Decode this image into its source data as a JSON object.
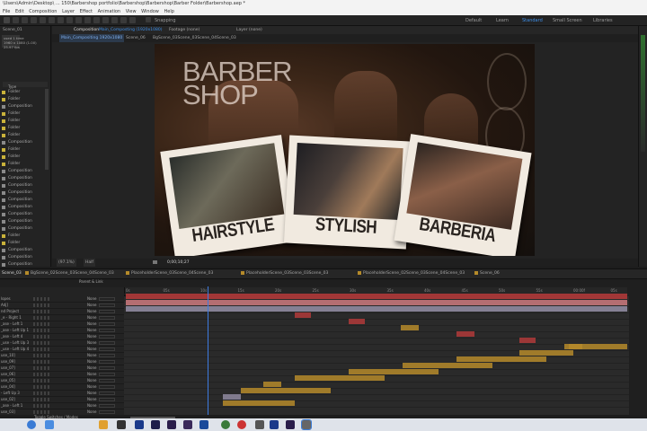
{
  "window": {
    "title": "\\Users\\Admin\\Desktop\\ ... 150\\Barbershop portfolio\\Barbershop\\Barbershop\\Barber Folder\\Barbershop.aep *",
    "menu": [
      "File",
      "Edit",
      "Composition",
      "Layer",
      "Effect",
      "Animation",
      "View",
      "Window",
      "Help"
    ]
  },
  "toolbar": {
    "snapping_label": "Snapping",
    "workspaces": [
      "Default",
      "Learn",
      "Standard",
      "Small Screen",
      "Libraries"
    ]
  },
  "project": {
    "title": "Scene_01",
    "info": [
      "used 1 time",
      "1960 x 1080 (1.00)",
      "25.97 fps"
    ],
    "header": "Type",
    "items": [
      "Folder",
      "Folder",
      "Composition",
      "Folder",
      "Folder",
      "Folder",
      "Folder",
      "Composition",
      "Folder",
      "Folder",
      "Folder",
      "Composition",
      "Composition",
      "Composition",
      "Composition",
      "Composition",
      "Composition",
      "Composition",
      "Composition",
      "Composition",
      "Folder",
      "Folder",
      "Composition",
      "Composition",
      "Composition",
      "Folder"
    ]
  },
  "composition": {
    "tab_label": "Composition",
    "comp_name": "Main_Composting (1920x1080)",
    "footage_label": "Footage (none)",
    "layer_label": "Layer (none)",
    "breadcrumbs": [
      "Main_Compositing 1920x1080",
      "Scene_06",
      "BgScene_03Scene_03Scene_04Scene_03"
    ],
    "shop_title_line1": "BARBER",
    "shop_title_line2": "SHOP",
    "cards": [
      "HAIRSTYLE",
      "STYLISH",
      "BARBERIA"
    ],
    "zoom": "(97.1%)",
    "resolution": "Half",
    "timecode": "0;00;10;27"
  },
  "timeline": {
    "tabs": [
      "Scene_03",
      "BgScene_02Scene_03Scene_04Scene_03",
      "PlaceholderScene_03Scene_04Scene_03",
      "PlaceholderScene_03Scene_03Scene_03",
      "PlaceholderScene_02Scene_03Scene_04Scene_03",
      "Scene_06"
    ],
    "column_header": "Parent & Link",
    "ruler_ticks": [
      "0s",
      "05s",
      "10s",
      "15s",
      "20s",
      "25s",
      "30s",
      "35s",
      "40s",
      "45s",
      "50s",
      "55s",
      "00:00f",
      "05s"
    ],
    "layers": [
      {
        "name": "lopes",
        "parent": "None"
      },
      {
        "name": "Adj]",
        "parent": "None"
      },
      {
        "name": "nd Project",
        "parent": "None"
      },
      {
        "name": "_e - Right 1",
        "parent": "None"
      },
      {
        "name": "_ase - Left 1",
        "parent": "None"
      },
      {
        "name": "_ase - Left Up 1",
        "parent": "None"
      },
      {
        "name": "_ase - Left 4",
        "parent": "None"
      },
      {
        "name": "_use - Left Up 3",
        "parent": "None"
      },
      {
        "name": "_use - Left Up 4",
        "parent": "None"
      },
      {
        "name": "use_10]",
        "parent": "None"
      },
      {
        "name": "use_09]",
        "parent": "None"
      },
      {
        "name": "use_07]",
        "parent": "None"
      },
      {
        "name": "use_06]",
        "parent": "None"
      },
      {
        "name": "use_05]",
        "parent": "None"
      },
      {
        "name": "use_04]",
        "parent": "None"
      },
      {
        "name": "- Left Up 3",
        "parent": "None"
      },
      {
        "name": "use_02]",
        "parent": "None"
      },
      {
        "name": "_ase - Left 1",
        "parent": "None"
      },
      {
        "name": "use_03]",
        "parent": "None"
      }
    ],
    "footer_label": "Toggle Switches / Modes"
  },
  "colors": {
    "accent": "#3d8ee8",
    "bar_red": "#b03a3a",
    "bar_pink": "#c4757a",
    "bar_lilac": "#8f8aa0",
    "bar_gold": "#b58a2a",
    "folder_yellow": "#c9b23a"
  }
}
